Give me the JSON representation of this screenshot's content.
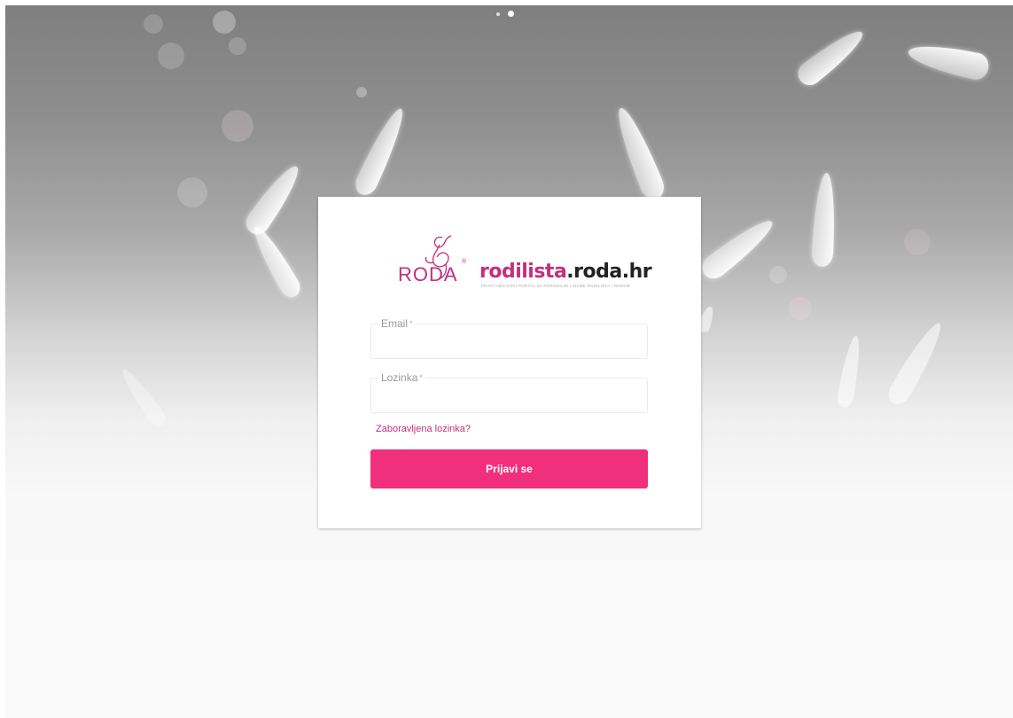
{
  "carousel": {
    "indicators": 2,
    "active_index": 1
  },
  "brand": {
    "roda_logo_text": "RODA",
    "roda_registered": "®",
    "site_name_part1": "rodilista",
    "site_name_part2": ".roda.hr",
    "tagline": "PRAVI HRVATSKI PORTAL ZA PORODILJE I MAME RODILIŠTA I RODIJE",
    "accent_color": "#c2307a"
  },
  "form": {
    "email": {
      "label": "Email",
      "required_marker": "*",
      "value": ""
    },
    "password": {
      "label": "Lozinka",
      "required_marker": "*",
      "value": ""
    },
    "forgot_password_link": "Zaboravljena lozinka?",
    "submit_label": "Prijavi se",
    "submit_color": "#f0307c"
  }
}
